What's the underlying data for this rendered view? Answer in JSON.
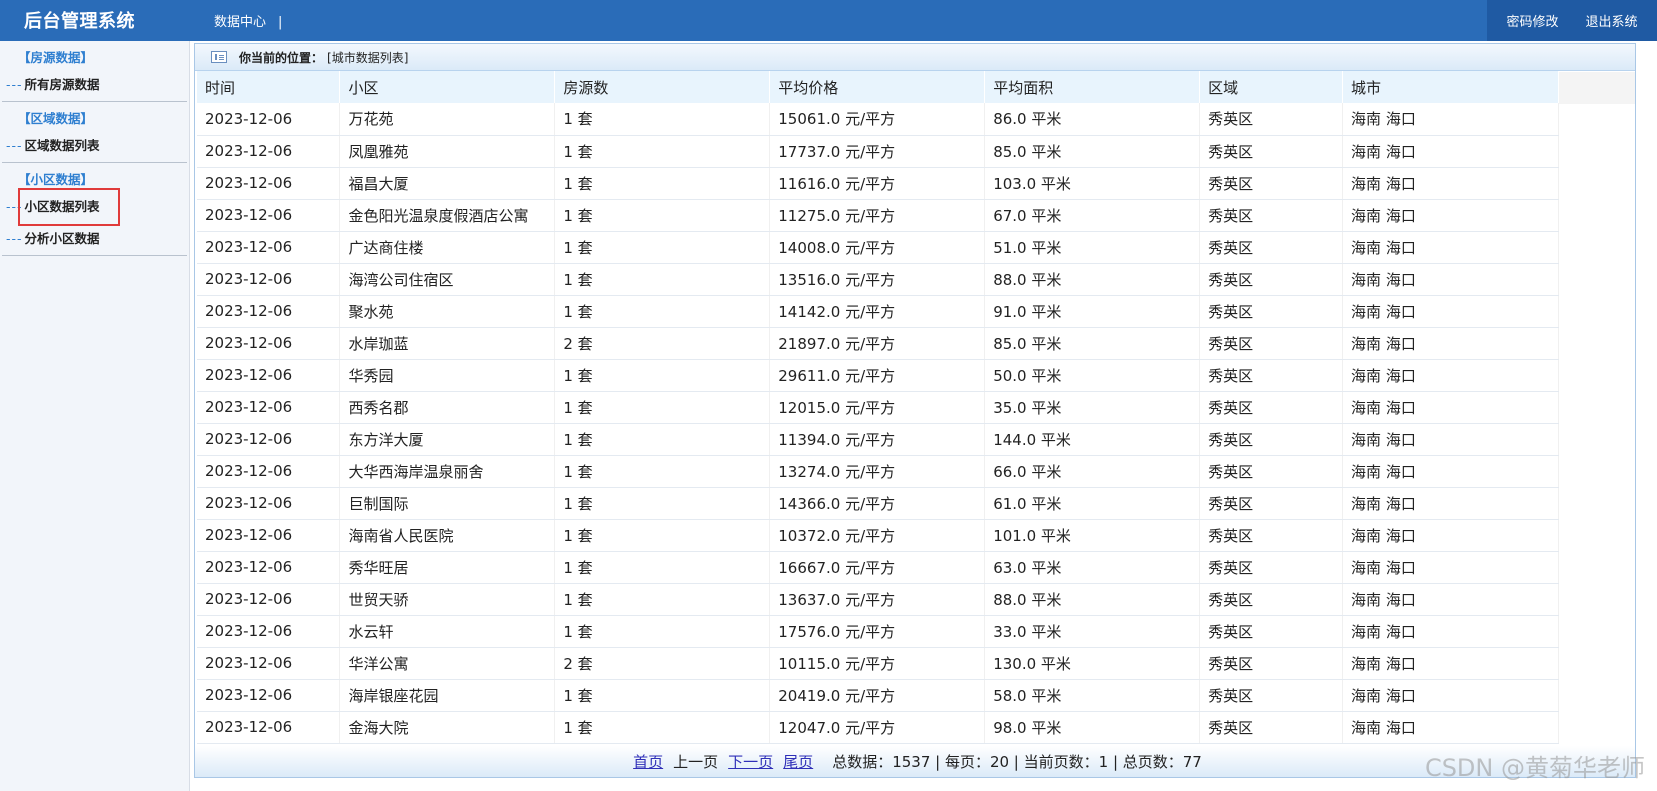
{
  "header": {
    "brand": "后台管理系统",
    "nav": "数据中心",
    "nav_sep": "|",
    "change_password": "密码修改",
    "logout": "退出系统"
  },
  "sidebar": {
    "groups": [
      {
        "title": "【房源数据】",
        "items": [
          {
            "label": "所有房源数据",
            "prefix": "---"
          }
        ]
      },
      {
        "title": "【区域数据】",
        "items": [
          {
            "label": "区域数据列表",
            "prefix": "---"
          }
        ]
      },
      {
        "title": "【小区数据】",
        "items": [
          {
            "label": "小区数据列表",
            "prefix": "---"
          },
          {
            "label": "分析小区数据",
            "prefix": "---"
          }
        ]
      }
    ]
  },
  "breadcrumb": {
    "label": "你当前的位置：",
    "path": "[城市数据列表]"
  },
  "table": {
    "headers": [
      "时间",
      "小区",
      "房源数",
      "平均价格",
      "平均面积",
      "区域",
      "城市"
    ],
    "rows": [
      [
        "2023-12-06",
        "万花苑",
        "1 套",
        "15061.0 元/平方",
        "86.0 平米",
        "秀英区",
        "海南 海口"
      ],
      [
        "2023-12-06",
        "凤凰雅苑",
        "1 套",
        "17737.0 元/平方",
        "85.0 平米",
        "秀英区",
        "海南 海口"
      ],
      [
        "2023-12-06",
        "福昌大厦",
        "1 套",
        "11616.0 元/平方",
        "103.0 平米",
        "秀英区",
        "海南 海口"
      ],
      [
        "2023-12-06",
        "金色阳光温泉度假酒店公寓",
        "1 套",
        "11275.0 元/平方",
        "67.0 平米",
        "秀英区",
        "海南 海口"
      ],
      [
        "2023-12-06",
        "广达商住楼",
        "1 套",
        "14008.0 元/平方",
        "51.0 平米",
        "秀英区",
        "海南 海口"
      ],
      [
        "2023-12-06",
        "海湾公司住宿区",
        "1 套",
        "13516.0 元/平方",
        "88.0 平米",
        "秀英区",
        "海南 海口"
      ],
      [
        "2023-12-06",
        "聚水苑",
        "1 套",
        "14142.0 元/平方",
        "91.0 平米",
        "秀英区",
        "海南 海口"
      ],
      [
        "2023-12-06",
        "水岸珈蓝",
        "2 套",
        "21897.0 元/平方",
        "85.0 平米",
        "秀英区",
        "海南 海口"
      ],
      [
        "2023-12-06",
        "华秀园",
        "1 套",
        "29611.0 元/平方",
        "50.0 平米",
        "秀英区",
        "海南 海口"
      ],
      [
        "2023-12-06",
        "西秀名郡",
        "1 套",
        "12015.0 元/平方",
        "35.0 平米",
        "秀英区",
        "海南 海口"
      ],
      [
        "2023-12-06",
        "东方洋大厦",
        "1 套",
        "11394.0 元/平方",
        "144.0 平米",
        "秀英区",
        "海南 海口"
      ],
      [
        "2023-12-06",
        "大华西海岸温泉丽舍",
        "1 套",
        "13274.0 元/平方",
        "66.0 平米",
        "秀英区",
        "海南 海口"
      ],
      [
        "2023-12-06",
        "巨制国际",
        "1 套",
        "14366.0 元/平方",
        "61.0 平米",
        "秀英区",
        "海南 海口"
      ],
      [
        "2023-12-06",
        "海南省人民医院",
        "1 套",
        "10372.0 元/平方",
        "101.0 平米",
        "秀英区",
        "海南 海口"
      ],
      [
        "2023-12-06",
        "秀华旺居",
        "1 套",
        "16667.0 元/平方",
        "63.0 平米",
        "秀英区",
        "海南 海口"
      ],
      [
        "2023-12-06",
        "世贸天骄",
        "1 套",
        "13637.0 元/平方",
        "88.0 平米",
        "秀英区",
        "海南 海口"
      ],
      [
        "2023-12-06",
        "水云轩",
        "1 套",
        "17576.0 元/平方",
        "33.0 平米",
        "秀英区",
        "海南 海口"
      ],
      [
        "2023-12-06",
        "华洋公寓",
        "2 套",
        "10115.0 元/平方",
        "130.0 平米",
        "秀英区",
        "海南 海口"
      ],
      [
        "2023-12-06",
        "海岸银座花园",
        "1 套",
        "20419.0 元/平方",
        "58.0 平米",
        "秀英区",
        "海南 海口"
      ],
      [
        "2023-12-06",
        "金海大院",
        "1 套",
        "12047.0 元/平方",
        "98.0 平米",
        "秀英区",
        "海南 海口"
      ]
    ]
  },
  "pager": {
    "first": "首页",
    "prev": "上一页",
    "next": "下一页",
    "last": "尾页",
    "stats": "总数据：1537 | 每页：20 | 当前页数：1 | 总页数：77"
  },
  "watermark": "CSDN @黄菊华老师"
}
